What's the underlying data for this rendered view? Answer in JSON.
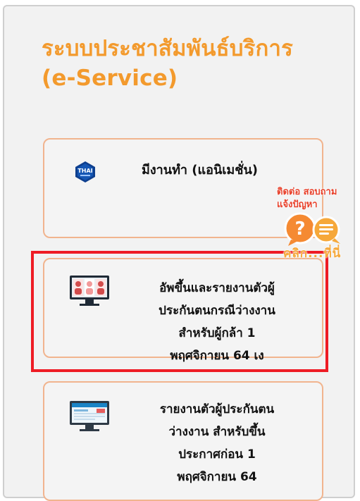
{
  "header": {
    "title_line1": "ระบบประชาสัมพันธ์บริการ",
    "title_line2": "(e-Service)"
  },
  "cards": [
    {
      "icon": "thai-logo-icon",
      "logo_text": "THAI",
      "lines": [
        "มีงานทำ (แอนิเมชั่น)"
      ]
    },
    {
      "icon": "video-call-monitor-icon",
      "lines": [
        "อัพขึ้นและรายงานตัวผู้",
        "ประกันตนกรณีว่างงาน",
        "สำหรับผู้กล้า 1",
        "พฤศจิกายน 64 เง"
      ]
    },
    {
      "icon": "website-monitor-icon",
      "lines": [
        "รายงานตัวผู้ประกันตน",
        "ว่างงาน สำหรับขึ้น",
        "ประกาศก่อน 1",
        "พฤศจิกายน 64"
      ]
    }
  ],
  "contact": {
    "line1": "ติดต่อ สอบถาม",
    "line2": "แจ้งปัญหา",
    "click": "คลิก...ที่นี่"
  },
  "colors": {
    "title": "#f39a2d",
    "card_border": "#f1b48e",
    "highlight": "#ee1c25",
    "contact_text": "#e8402a",
    "thai_logo_blue": "#0e3f8e"
  }
}
